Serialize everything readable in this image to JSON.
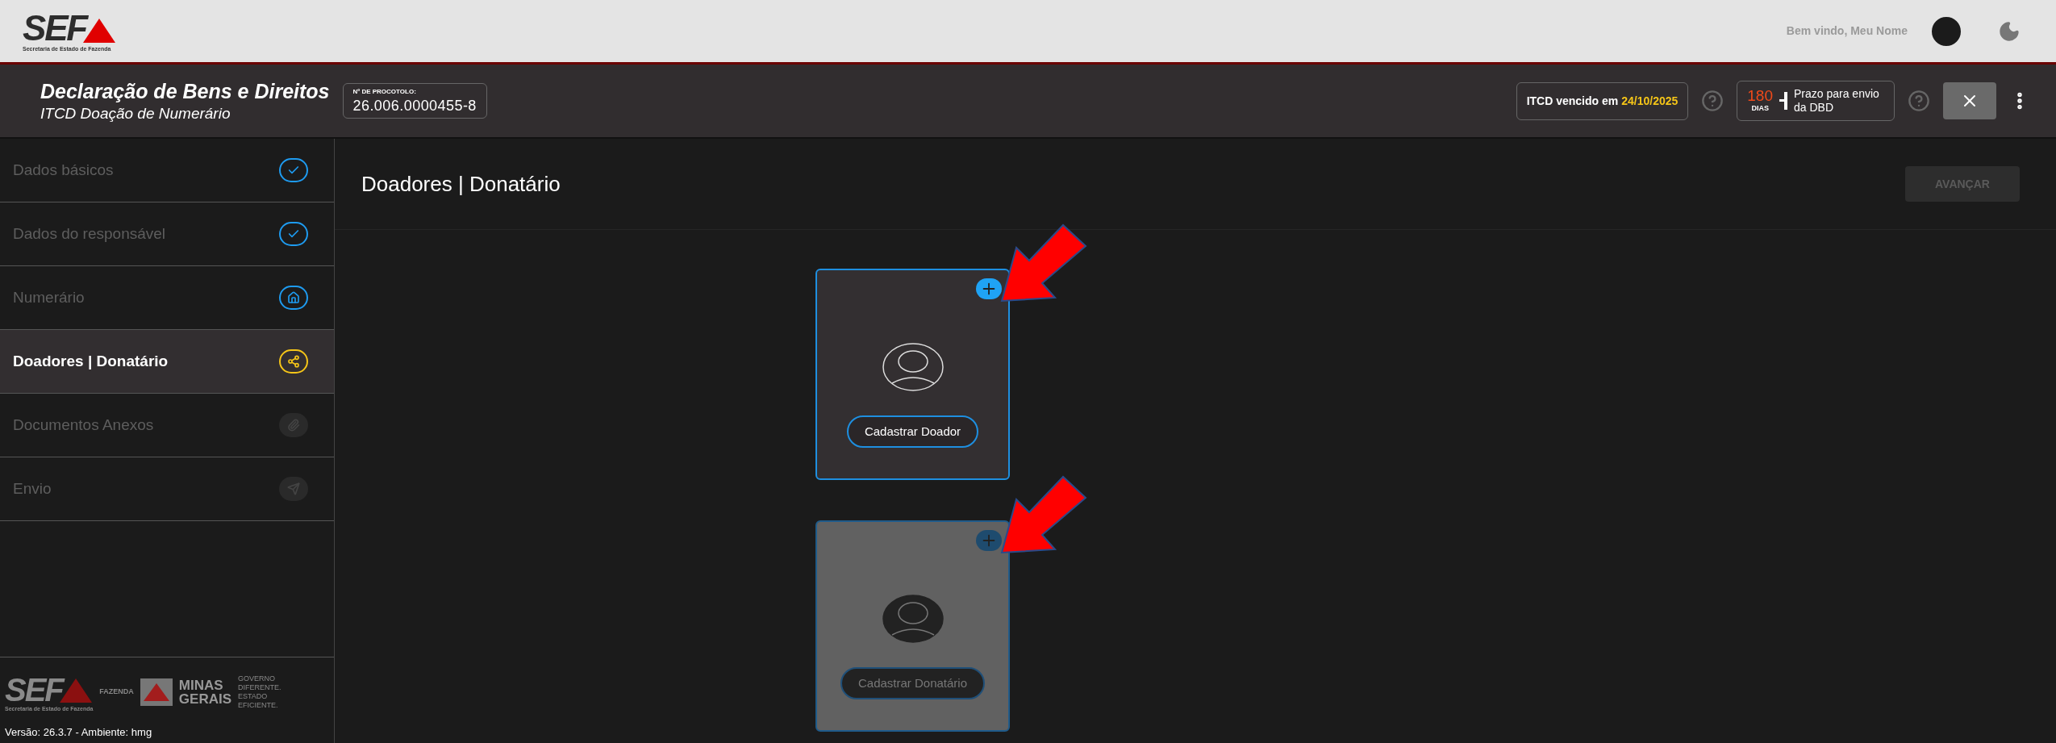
{
  "top_bar": {
    "logo": {
      "text": "SEF",
      "subtitle": "Secretaria de Estado de Fazenda"
    },
    "welcome": "Bem vindo, Meu Nome"
  },
  "header": {
    "title": "Declaração de Bens e Direitos",
    "subtitle": "ITCD Doação de Numerário",
    "protocol": {
      "label": "Nº DE PROCOTOLO:",
      "value": "26.006.0000455-8"
    },
    "due": {
      "text": "ITCD vencido em",
      "date": "24/10/2025"
    },
    "deadline": {
      "number": "180",
      "unit": "DIAS",
      "text": "Prazo para envio da DBD"
    }
  },
  "sidebar": {
    "items": [
      {
        "label": "Dados básicos",
        "selected": false,
        "kind": "done"
      },
      {
        "label": "Dados do responsável",
        "selected": false,
        "kind": "done"
      },
      {
        "label": "Numerário",
        "selected": false,
        "kind": "done"
      },
      {
        "label": "Doadores | Donatário",
        "selected": true,
        "kind": "current"
      },
      {
        "label": "Documentos Anexos",
        "selected": false,
        "kind": "pending"
      },
      {
        "label": "Envio",
        "selected": false,
        "kind": "pending"
      }
    ],
    "footer": {
      "sef": {
        "text": "SEF",
        "subtitle": "Secretaria de Estado de Fazenda",
        "tag": "FAZENDA"
      },
      "mg": {
        "line1": "MINAS",
        "line2": "GERAIS",
        "motto": "GOVERNO DIFERENTE. ESTADO EFICIENTE."
      },
      "version": "Versão: 26.3.7 - Ambiente: hmg"
    }
  },
  "main": {
    "title": "Doadores | Donatário",
    "next_button": {
      "label": "AVANÇAR",
      "disabled": true
    },
    "cards": [
      {
        "button": "Cadastrar Doador",
        "disabled": false
      },
      {
        "button": "Cadastrar Donatário",
        "disabled": true
      }
    ]
  }
}
